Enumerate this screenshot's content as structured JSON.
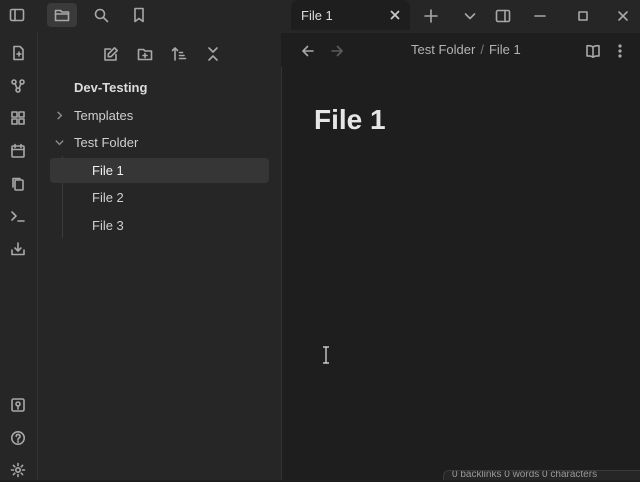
{
  "app": {
    "window_controls": {
      "minimize": "−",
      "maximize": "□",
      "close": "✕"
    }
  },
  "top_left": {
    "buttons": [
      "sidebar-toggle-icon",
      "folder-icon",
      "search-icon",
      "bookmark-icon"
    ],
    "active": "folder-icon"
  },
  "ribbon": {
    "items": [
      "file-open-icon",
      "graph-icon",
      "layout-icon",
      "calendar-icon",
      "copy-icon",
      "terminal-icon",
      "import-icon"
    ],
    "bottom": [
      "vault-icon",
      "help-icon",
      "settings-icon"
    ]
  },
  "explorer": {
    "actions": [
      "new-note-icon",
      "new-folder-icon",
      "sort-icon",
      "collapse-icon"
    ],
    "vault_name": "Dev-Testing",
    "tree": [
      {
        "label": "Templates",
        "type": "folder",
        "expanded": false
      },
      {
        "label": "Test Folder",
        "type": "folder",
        "expanded": true
      },
      {
        "label": "File 1",
        "type": "file",
        "active": true
      },
      {
        "label": "File 2",
        "type": "file",
        "active": false
      },
      {
        "label": "File 3",
        "type": "file",
        "active": false
      }
    ]
  },
  "tabs": {
    "items": [
      {
        "title": "File 1"
      }
    ],
    "new_tab": "+"
  },
  "view_header": {
    "breadcrumb": {
      "folder": "Test Folder",
      "separator": "/",
      "file": "File 1"
    }
  },
  "document": {
    "title": "File 1"
  },
  "status_bar": {
    "text": "0 backlinks   0 words   0 characters"
  },
  "colors": {
    "background": "#1e1e1e",
    "sidebar": "#262626",
    "active_item": "#363636"
  }
}
